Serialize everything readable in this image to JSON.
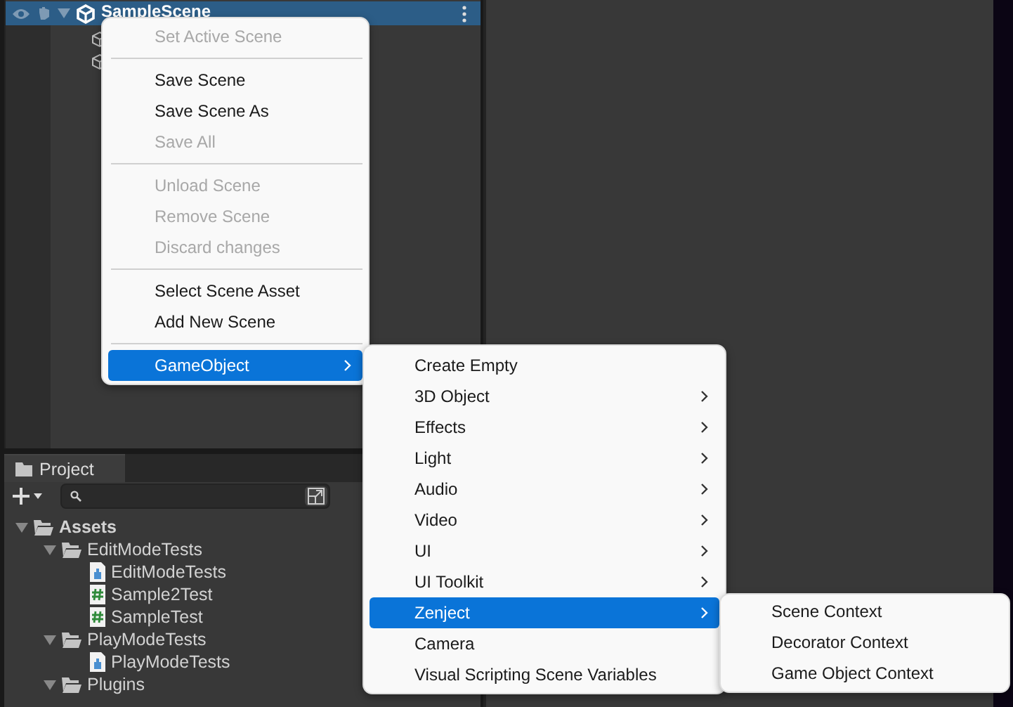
{
  "hierarchy": {
    "scene": {
      "name": "SampleScene",
      "selected": true,
      "expanded": true
    }
  },
  "project_panel": {
    "tab": "Project",
    "tree": [
      {
        "name": "Assets",
        "kind": "folder",
        "expanded": true,
        "bold": true,
        "children": [
          {
            "name": "EditModeTests",
            "kind": "folder",
            "expanded": true,
            "children": [
              {
                "name": "EditModeTests",
                "kind": "asmdef"
              },
              {
                "name": "Sample2Test",
                "kind": "script"
              },
              {
                "name": "SampleTest",
                "kind": "script"
              }
            ]
          },
          {
            "name": "PlayModeTests",
            "kind": "folder",
            "expanded": true,
            "children": [
              {
                "name": "PlayModeTests",
                "kind": "asmdef"
              }
            ]
          },
          {
            "name": "Plugins",
            "kind": "folder",
            "expanded": true
          }
        ]
      }
    ]
  },
  "context_menu": [
    {
      "kind": "item",
      "label": "Set Active Scene",
      "disabled": true,
      "selected": false,
      "submenu": false
    },
    {
      "kind": "separator"
    },
    {
      "kind": "item",
      "label": "Save Scene",
      "disabled": false,
      "selected": false,
      "submenu": false
    },
    {
      "kind": "item",
      "label": "Save Scene As",
      "disabled": false,
      "selected": false,
      "submenu": false
    },
    {
      "kind": "item",
      "label": "Save All",
      "disabled": true,
      "selected": false,
      "submenu": false
    },
    {
      "kind": "separator"
    },
    {
      "kind": "item",
      "label": "Unload Scene",
      "disabled": true,
      "selected": false,
      "submenu": false
    },
    {
      "kind": "item",
      "label": "Remove Scene",
      "disabled": true,
      "selected": false,
      "submenu": false
    },
    {
      "kind": "item",
      "label": "Discard changes",
      "disabled": true,
      "selected": false,
      "submenu": false
    },
    {
      "kind": "separator"
    },
    {
      "kind": "item",
      "label": "Select Scene Asset",
      "disabled": false,
      "selected": false,
      "submenu": false
    },
    {
      "kind": "item",
      "label": "Add New Scene",
      "disabled": false,
      "selected": false,
      "submenu": false
    },
    {
      "kind": "separator"
    },
    {
      "kind": "item",
      "label": "GameObject",
      "disabled": false,
      "selected": true,
      "submenu": true
    }
  ],
  "gameobject_submenu": [
    {
      "kind": "item",
      "label": "Create Empty",
      "disabled": false,
      "selected": false,
      "submenu": false
    },
    {
      "kind": "item",
      "label": "3D Object",
      "disabled": false,
      "selected": false,
      "submenu": true
    },
    {
      "kind": "item",
      "label": "Effects",
      "disabled": false,
      "selected": false,
      "submenu": true
    },
    {
      "kind": "item",
      "label": "Light",
      "disabled": false,
      "selected": false,
      "submenu": true
    },
    {
      "kind": "item",
      "label": "Audio",
      "disabled": false,
      "selected": false,
      "submenu": true
    },
    {
      "kind": "item",
      "label": "Video",
      "disabled": false,
      "selected": false,
      "submenu": true
    },
    {
      "kind": "item",
      "label": "UI",
      "disabled": false,
      "selected": false,
      "submenu": true
    },
    {
      "kind": "item",
      "label": "UI Toolkit",
      "disabled": false,
      "selected": false,
      "submenu": true
    },
    {
      "kind": "item",
      "label": "Zenject",
      "disabled": false,
      "selected": true,
      "submenu": true
    },
    {
      "kind": "item",
      "label": "Camera",
      "disabled": false,
      "selected": false,
      "submenu": false
    },
    {
      "kind": "item",
      "label": "Visual Scripting Scene Variables",
      "disabled": false,
      "selected": false,
      "submenu": false
    }
  ],
  "zenject_submenu": [
    {
      "kind": "item",
      "label": "Scene Context",
      "disabled": false,
      "selected": false,
      "submenu": false
    },
    {
      "kind": "item",
      "label": "Decorator Context",
      "disabled": false,
      "selected": false,
      "submenu": false
    },
    {
      "kind": "item",
      "label": "Game Object Context",
      "disabled": false,
      "selected": false,
      "submenu": false
    }
  ]
}
